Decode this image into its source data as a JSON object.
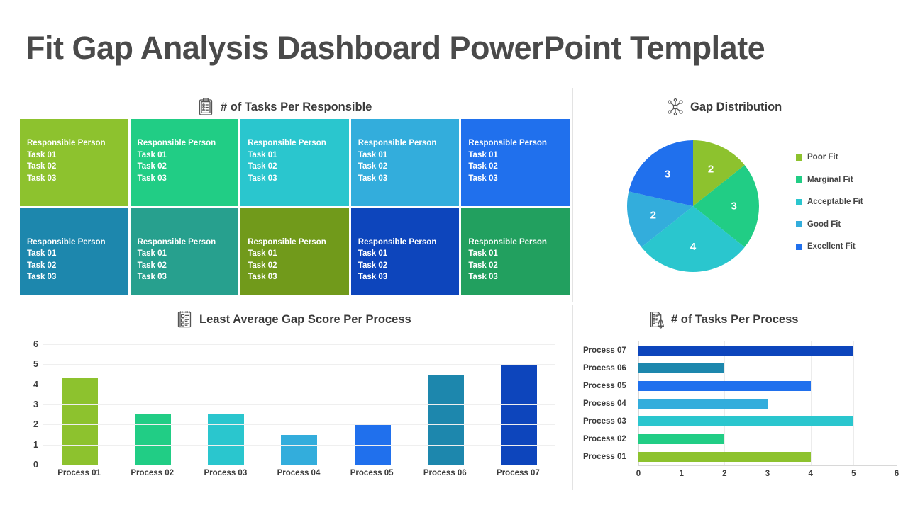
{
  "title": "Fit Gap Analysis Dashboard PowerPoint Template",
  "panels": {
    "tasks_per_responsible": {
      "title": "# of Tasks Per Responsible",
      "icon": "clipboard-checklist-icon"
    },
    "gap_distribution": {
      "title": "Gap Distribution",
      "icon": "network-hub-icon"
    },
    "least_average_gap": {
      "title": "Least Average Gap Score Per Process",
      "icon": "clipboard-rating-icon"
    },
    "tasks_per_process": {
      "title": "# of Tasks Per Process",
      "icon": "document-bell-icon"
    }
  },
  "responsible_grid": {
    "cells": [
      {
        "name": "Responsible Person",
        "tasks": [
          "Task 01",
          "Task 02",
          "Task 03"
        ],
        "color": "#8DC22E"
      },
      {
        "name": "Responsible Person",
        "tasks": [
          "Task 01",
          "Task 02",
          "Task 03"
        ],
        "color": "#21CD85"
      },
      {
        "name": "Responsible Person",
        "tasks": [
          "Task 01",
          "Task 02",
          "Task 03"
        ],
        "color": "#2AC6CE"
      },
      {
        "name": "Responsible Person",
        "tasks": [
          "Task 01",
          "Task 02",
          "Task 03"
        ],
        "color": "#33ADDC"
      },
      {
        "name": "Responsible Person",
        "tasks": [
          "Task 01",
          "Task 02",
          "Task 03"
        ],
        "color": "#2070ED"
      },
      {
        "name": "Responsible Person",
        "tasks": [
          "Task 01",
          "Task 02",
          "Task 03"
        ],
        "color": "#1D87AD"
      },
      {
        "name": "Responsible Person",
        "tasks": [
          "Task 01",
          "Task 02",
          "Task 03"
        ],
        "color": "#27A08E"
      },
      {
        "name": "Responsible Person",
        "tasks": [
          "Task 01",
          "Task 02",
          "Task 03"
        ],
        "color": "#719A1B"
      },
      {
        "name": "Responsible Person",
        "tasks": [
          "Task 01",
          "Task 02",
          "Task 03"
        ],
        "color": "#0D45BC"
      },
      {
        "name": "Responsible Person",
        "tasks": [
          "Task 01",
          "Task 02",
          "Task 03"
        ],
        "color": "#22A05F"
      }
    ]
  },
  "chart_data": [
    {
      "id": "gap_distribution_pie",
      "type": "pie",
      "title": "Gap Distribution",
      "legend_position": "right",
      "categories": [
        "Poor Fit",
        "Marginal Fit",
        "Acceptable Fit",
        "Good Fit",
        "Excellent Fit"
      ],
      "values": [
        2,
        3,
        4,
        2,
        3
      ],
      "total": 14,
      "colors": [
        "#8DC22E",
        "#21CD85",
        "#2AC6CE",
        "#33ADDC",
        "#2070ED"
      ],
      "start_angle_deg": 0,
      "direction": "clockwise"
    },
    {
      "id": "least_average_gap_bar",
      "type": "bar",
      "title": "Least Average Gap Score Per Process",
      "orientation": "vertical",
      "xlabel": "",
      "ylabel": "",
      "ylim": [
        0,
        6
      ],
      "yticks": [
        0,
        1,
        2,
        3,
        4,
        5,
        6
      ],
      "grid": true,
      "categories": [
        "Process 01",
        "Process 02",
        "Process 03",
        "Process 04",
        "Process 05",
        "Process 06",
        "Process 07"
      ],
      "values": [
        4.3,
        2.5,
        2.5,
        1.5,
        2.0,
        4.5,
        5.0
      ],
      "colors": [
        "#8DC22E",
        "#21CD85",
        "#2AC6CE",
        "#33ADDC",
        "#2070ED",
        "#1D87AD",
        "#0D45BC"
      ]
    },
    {
      "id": "tasks_per_process_bar",
      "type": "bar",
      "title": "# of Tasks Per Process",
      "orientation": "horizontal",
      "xlabel": "",
      "ylabel": "",
      "xlim": [
        0,
        6
      ],
      "xticks": [
        0,
        1,
        2,
        3,
        4,
        5,
        6
      ],
      "grid": true,
      "categories": [
        "Process 07",
        "Process 06",
        "Process 05",
        "Process 04",
        "Process 03",
        "Process 02",
        "Process 01"
      ],
      "values": [
        5,
        2,
        4,
        3,
        5,
        2,
        4
      ],
      "colors": [
        "#0D45BC",
        "#1D87AD",
        "#2070ED",
        "#33ADDC",
        "#2AC6CE",
        "#21CD85",
        "#8DC22E"
      ]
    }
  ]
}
